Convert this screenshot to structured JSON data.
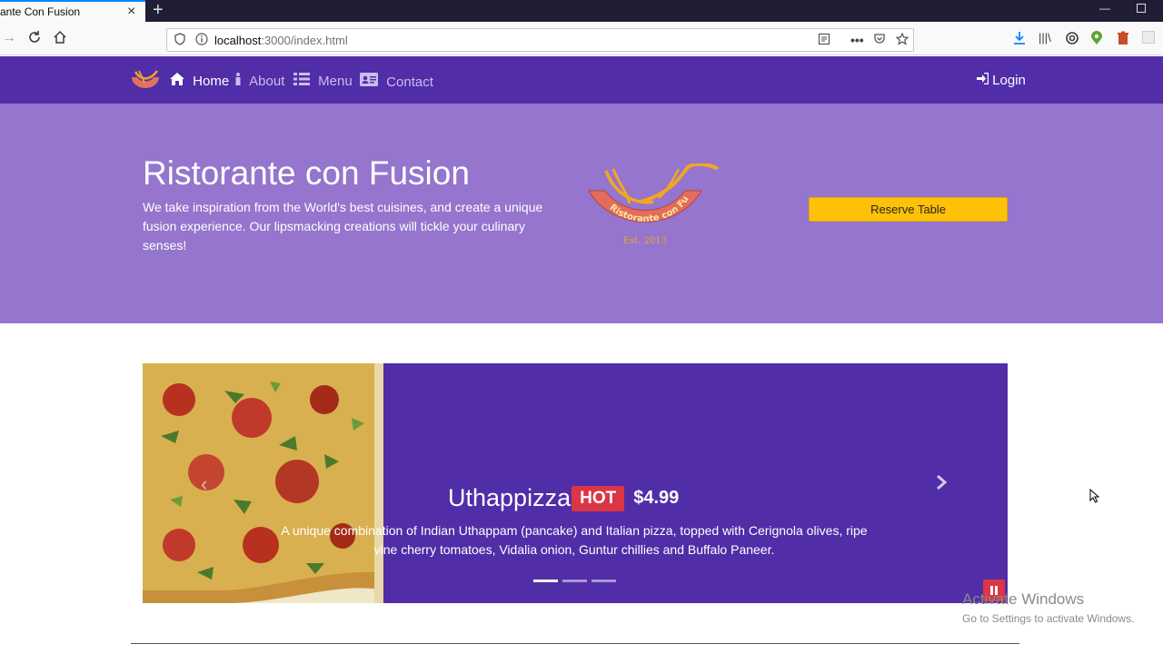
{
  "browser": {
    "tab_title": "ante Con Fusion",
    "url_host": "localhost",
    "url_rest": ":3000/index.html"
  },
  "site_nav": {
    "items": [
      {
        "label": "Home",
        "icon": "home-icon",
        "active": true
      },
      {
        "label": "About",
        "icon": "info-icon",
        "active": false
      },
      {
        "label": "Menu",
        "icon": "list-icon",
        "active": false
      },
      {
        "label": "Contact",
        "icon": "address-card-icon",
        "active": false
      }
    ],
    "login_label": "Login"
  },
  "jumbotron": {
    "title": "Ristorante con Fusion",
    "description": "We take inspiration from the World's best cuisines, and create a unique fusion experience. Our lipsmacking creations will tickle your culinary senses!",
    "reserve_label": "Reserve Table",
    "logo_text": "Ristorante con Fusion",
    "logo_est": "Est. 2013"
  },
  "carousel": {
    "dish_name": "Uthappizza",
    "badge": "HOT",
    "price": "$4.99",
    "description": "A unique combination of Indian Uthappam (pancake) and Italian pizza, topped with Cerignola olives, ripe vine cherry tomatoes, Vidalia onion, Guntur chillies and Buffalo Paneer.",
    "active_slide": 1,
    "slide_count": 3
  },
  "os_watermark": {
    "title": "Activate Windows",
    "subtitle": "Go to Settings to activate Windows."
  },
  "colors": {
    "primary": "#512da8",
    "light": "#9575cd",
    "warning": "#ffc107",
    "danger": "#dc3545"
  }
}
